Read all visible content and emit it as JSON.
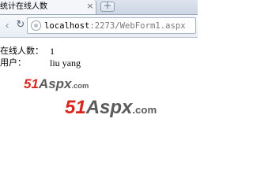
{
  "tab": {
    "title": "统计在线人数",
    "close_icon": "close-icon",
    "new_tab_symbol": "+"
  },
  "toolbar": {
    "back_symbol": "‹",
    "forward_symbol": "›",
    "reload_symbol": "↻",
    "url_host": "localhost",
    "url_rest": ":2273/WebForm1.aspx"
  },
  "content": {
    "online_label": "在线人数：",
    "online_count": "1",
    "user_label": "用户：",
    "user_name": "liu yang"
  },
  "watermark": {
    "number": "51",
    "text": "Aspx",
    "domain": ".com",
    "colors": {
      "number": "#d9261c",
      "text": "#5b5b5b"
    }
  }
}
